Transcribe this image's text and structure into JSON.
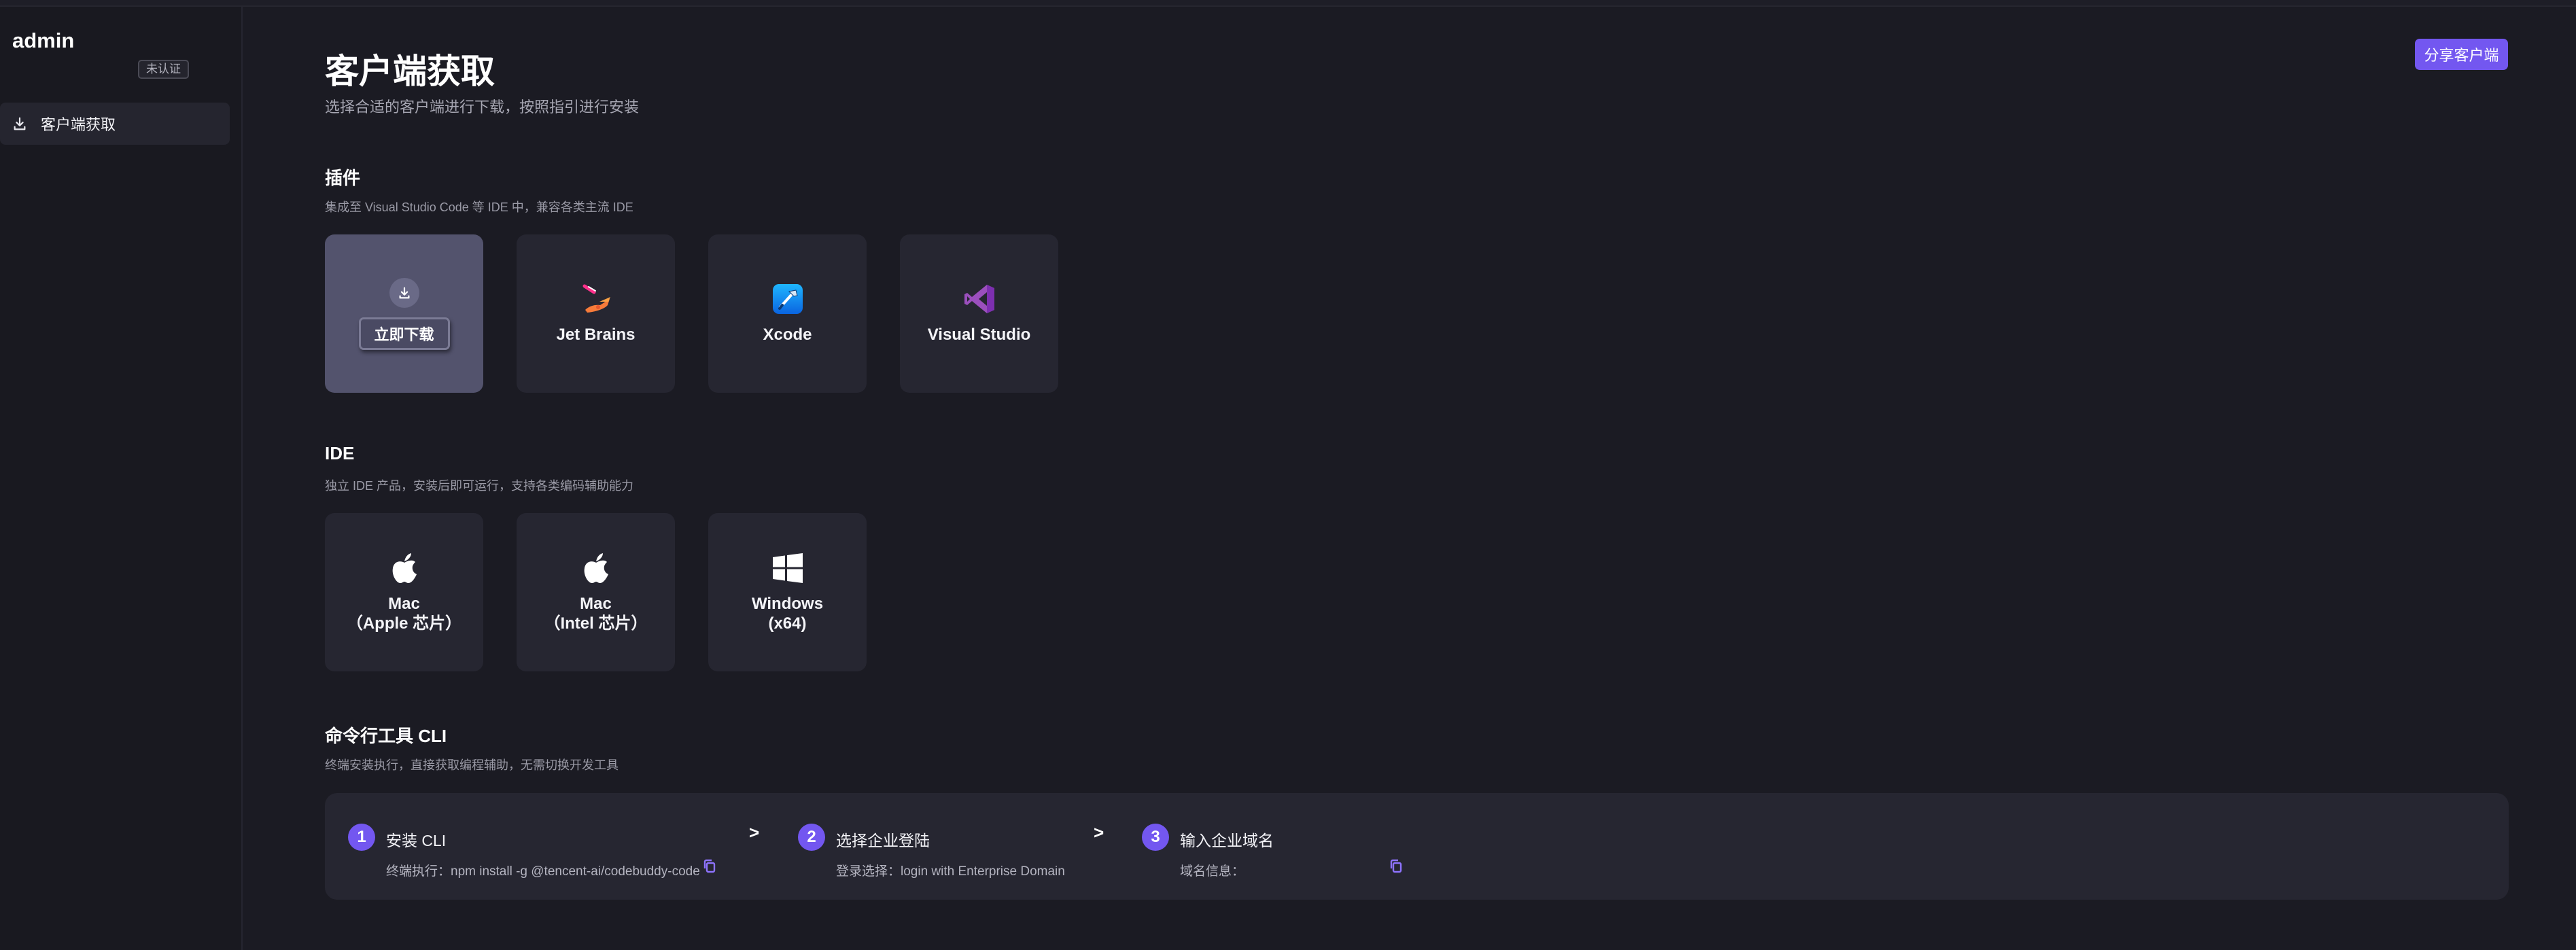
{
  "sidebar": {
    "brand": "admin",
    "badge": "未认证",
    "nav_items": [
      {
        "label": "客户端获取",
        "icon": "download-icon"
      }
    ]
  },
  "header": {
    "title": "客户端获取",
    "subtitle": "选择合适的客户端进行下载，按照指引进行安装",
    "share_button": "分享客户端"
  },
  "plugins": {
    "title": "插件",
    "desc": "集成至 Visual Studio Code 等 IDE 中，兼容各类主流 IDE",
    "download_button": "立即下载",
    "cards": [
      {
        "label": "Jet Brains",
        "icon": "jetbrains-icon"
      },
      {
        "label": "Xcode",
        "icon": "xcode-icon"
      },
      {
        "label": "Visual Studio",
        "icon": "visual-studio-icon"
      }
    ]
  },
  "ide": {
    "title": "IDE",
    "desc": "独立 IDE 产品，安装后即可运行，支持各类编码辅助能力",
    "cards": [
      {
        "line1": "Mac",
        "line2": "（Apple 芯片）",
        "icon": "apple-icon"
      },
      {
        "line1": "Mac",
        "line2": "（Intel 芯片）",
        "icon": "apple-icon"
      },
      {
        "line1": "Windows",
        "line2": "(x64)",
        "icon": "windows-icon"
      }
    ]
  },
  "cli": {
    "title": "命令行工具 CLI",
    "desc": "终端安装执行，直接获取编程辅助，无需切换开发工具",
    "arrow": ">",
    "steps": [
      {
        "num": "1",
        "title": "安装 CLI",
        "detail": "终端执行：npm install -g @tencent-ai/codebuddy-code"
      },
      {
        "num": "2",
        "title": "选择企业登陆",
        "detail": "登录选择：login with Enterprise Domain"
      },
      {
        "num": "3",
        "title": "输入企业域名",
        "detail": "域名信息："
      }
    ]
  },
  "colors": {
    "accent": "#7357f0",
    "background": "#1b1b23",
    "card": "#262631",
    "card_active": "#53536d"
  }
}
